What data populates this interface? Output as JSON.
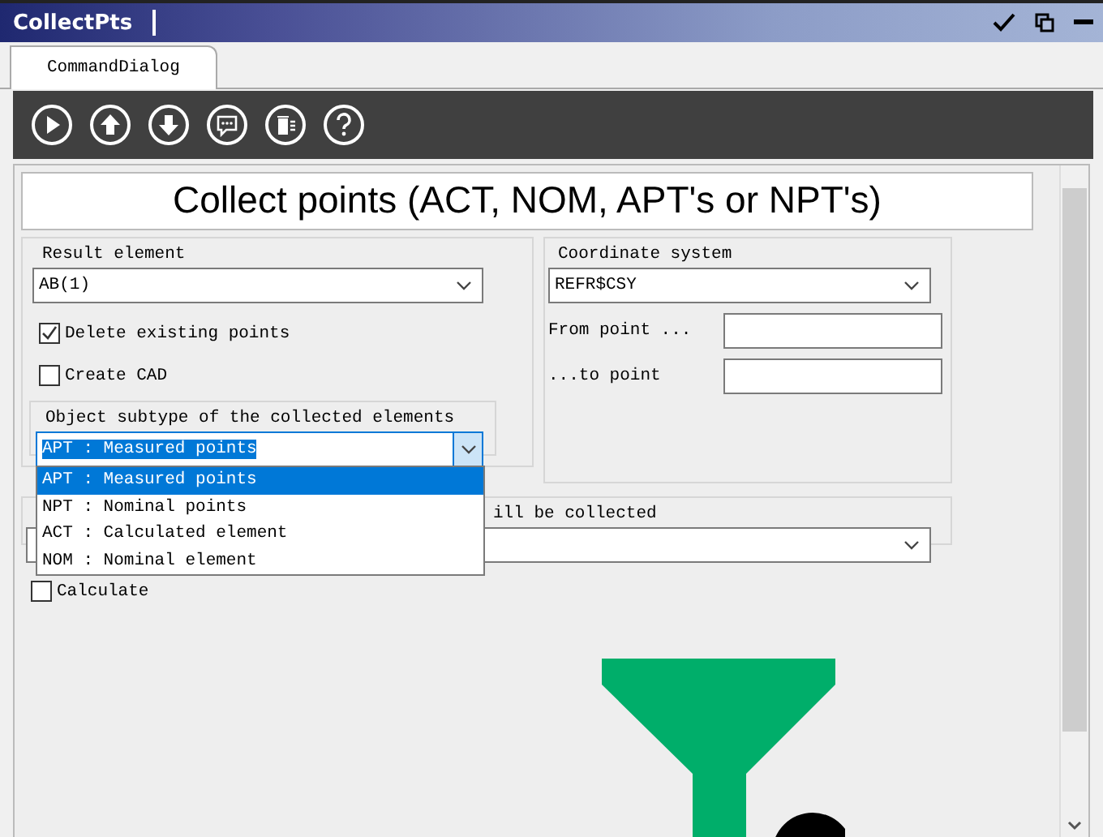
{
  "window": {
    "title": "CollectPts"
  },
  "tabs": [
    {
      "label": "CommandDialog",
      "selected": true
    }
  ],
  "heading": "Collect points (ACT, NOM, APT's or NPT's)",
  "result_element": {
    "label": "Result element",
    "value": "AB(1)"
  },
  "checkboxes": [
    {
      "label": "Delete existing points",
      "checked": true
    },
    {
      "label": "Create CAD",
      "checked": false
    }
  ],
  "object_subtype": {
    "label": "Object subtype of the collected elements",
    "value": "APT : Measured points",
    "expanded": true,
    "options": [
      {
        "label": "APT : Measured points",
        "selected": true
      },
      {
        "label": "NPT : Nominal points",
        "selected": false
      },
      {
        "label": "ACT : Calculated element",
        "selected": false
      },
      {
        "label": "NOM : Nominal element",
        "selected": false
      }
    ]
  },
  "coordinate_system": {
    "label": "Coordinate system",
    "value": "REFR$CSY"
  },
  "from_point": {
    "label": "From point ..."
  },
  "to_point": {
    "label": "...to point"
  },
  "collected_group": {
    "label": "ill be collected"
  },
  "calculate": {
    "label": "Calculate",
    "checked": false
  }
}
